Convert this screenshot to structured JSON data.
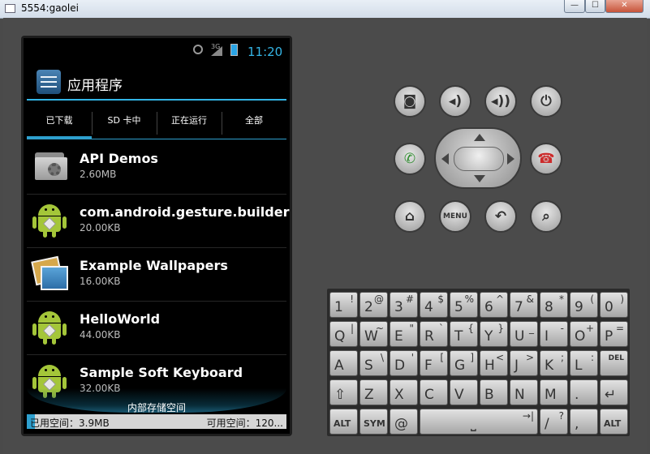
{
  "window": {
    "title": "5554:gaolei",
    "minimize_label": "—",
    "maximize_label": "☐",
    "close_label": "✕"
  },
  "status_bar": {
    "time": "11:20",
    "network": "3G"
  },
  "action_bar": {
    "title": "应用程序",
    "icon": "settings-icon"
  },
  "tabs": [
    {
      "label": "已下载",
      "selected": true
    },
    {
      "label": "SD 卡中",
      "selected": false
    },
    {
      "label": "正在运行",
      "selected": false
    },
    {
      "label": "全部",
      "selected": false
    }
  ],
  "apps": [
    {
      "name": "API Demos",
      "size": "2.60MB",
      "icon": "folder-gear-icon"
    },
    {
      "name": "com.android.gesture.builder",
      "size": "20.00KB",
      "icon": "android-icon"
    },
    {
      "name": "Example Wallpapers",
      "size": "16.00KB",
      "icon": "wallpaper-icon"
    },
    {
      "name": "HelloWorld",
      "size": "44.00KB",
      "icon": "android-icon"
    },
    {
      "name": "Sample Soft Keyboard",
      "size": "32.00KB",
      "icon": "android-icon"
    }
  ],
  "storage": {
    "label": "内部存储空间",
    "used": "已用空间：3.9MB",
    "free": "可用空间：120...",
    "used_fraction": 0.03
  },
  "controls": {
    "camera": "camera-icon",
    "volume_down": "volume-down-icon",
    "volume_up": "volume-up-icon",
    "power": "power-icon",
    "call": "call-icon",
    "end_call": "end-call-icon",
    "home": "home-icon",
    "menu_label": "MENU",
    "back": "back-icon",
    "search": "search-icon"
  },
  "keyboard": {
    "rows": [
      [
        {
          "m": "1",
          "s": "!"
        },
        {
          "m": "2",
          "s": "@"
        },
        {
          "m": "3",
          "s": "#"
        },
        {
          "m": "4",
          "s": "$"
        },
        {
          "m": "5",
          "s": "%"
        },
        {
          "m": "6",
          "s": "^"
        },
        {
          "m": "7",
          "s": "&"
        },
        {
          "m": "8",
          "s": "*"
        },
        {
          "m": "9",
          "s": "("
        },
        {
          "m": "0",
          "s": ")"
        }
      ],
      [
        {
          "m": "Q",
          "s": "|"
        },
        {
          "m": "W",
          "s": "~"
        },
        {
          "m": "E",
          "s": "\""
        },
        {
          "m": "R",
          "s": "`"
        },
        {
          "m": "T",
          "s": "{"
        },
        {
          "m": "Y",
          "s": "}"
        },
        {
          "m": "U",
          "s": "_"
        },
        {
          "m": "I",
          "s": "-"
        },
        {
          "m": "O",
          "s": "+"
        },
        {
          "m": "P",
          "s": "="
        }
      ],
      [
        {
          "m": "A",
          "s": ""
        },
        {
          "m": "S",
          "s": "\\"
        },
        {
          "m": "D",
          "s": "'"
        },
        {
          "m": "F",
          "s": "["
        },
        {
          "m": "G",
          "s": "]"
        },
        {
          "m": "H",
          "s": "<"
        },
        {
          "m": "J",
          "s": ">"
        },
        {
          "m": "K",
          "s": ";"
        },
        {
          "m": "L",
          "s": ":"
        },
        {
          "m": "",
          "s": "DEL"
        }
      ],
      [
        {
          "m": "⇧",
          "s": ""
        },
        {
          "m": "Z",
          "s": ""
        },
        {
          "m": "X",
          "s": ""
        },
        {
          "m": "C",
          "s": ""
        },
        {
          "m": "V",
          "s": ""
        },
        {
          "m": "B",
          "s": ""
        },
        {
          "m": "N",
          "s": ""
        },
        {
          "m": "M",
          "s": ""
        },
        {
          "m": ".",
          "s": ""
        },
        {
          "m": "↵",
          "s": ""
        }
      ],
      [
        {
          "m": "ALT",
          "s": ""
        },
        {
          "m": "SYM",
          "s": ""
        },
        {
          "m": "@",
          "s": ""
        },
        {
          "m": "⎵",
          "s": "→|"
        },
        {
          "m": "/",
          "s": "?"
        },
        {
          "m": ",",
          "s": ""
        },
        {
          "m": "ALT",
          "s": ""
        }
      ]
    ]
  }
}
